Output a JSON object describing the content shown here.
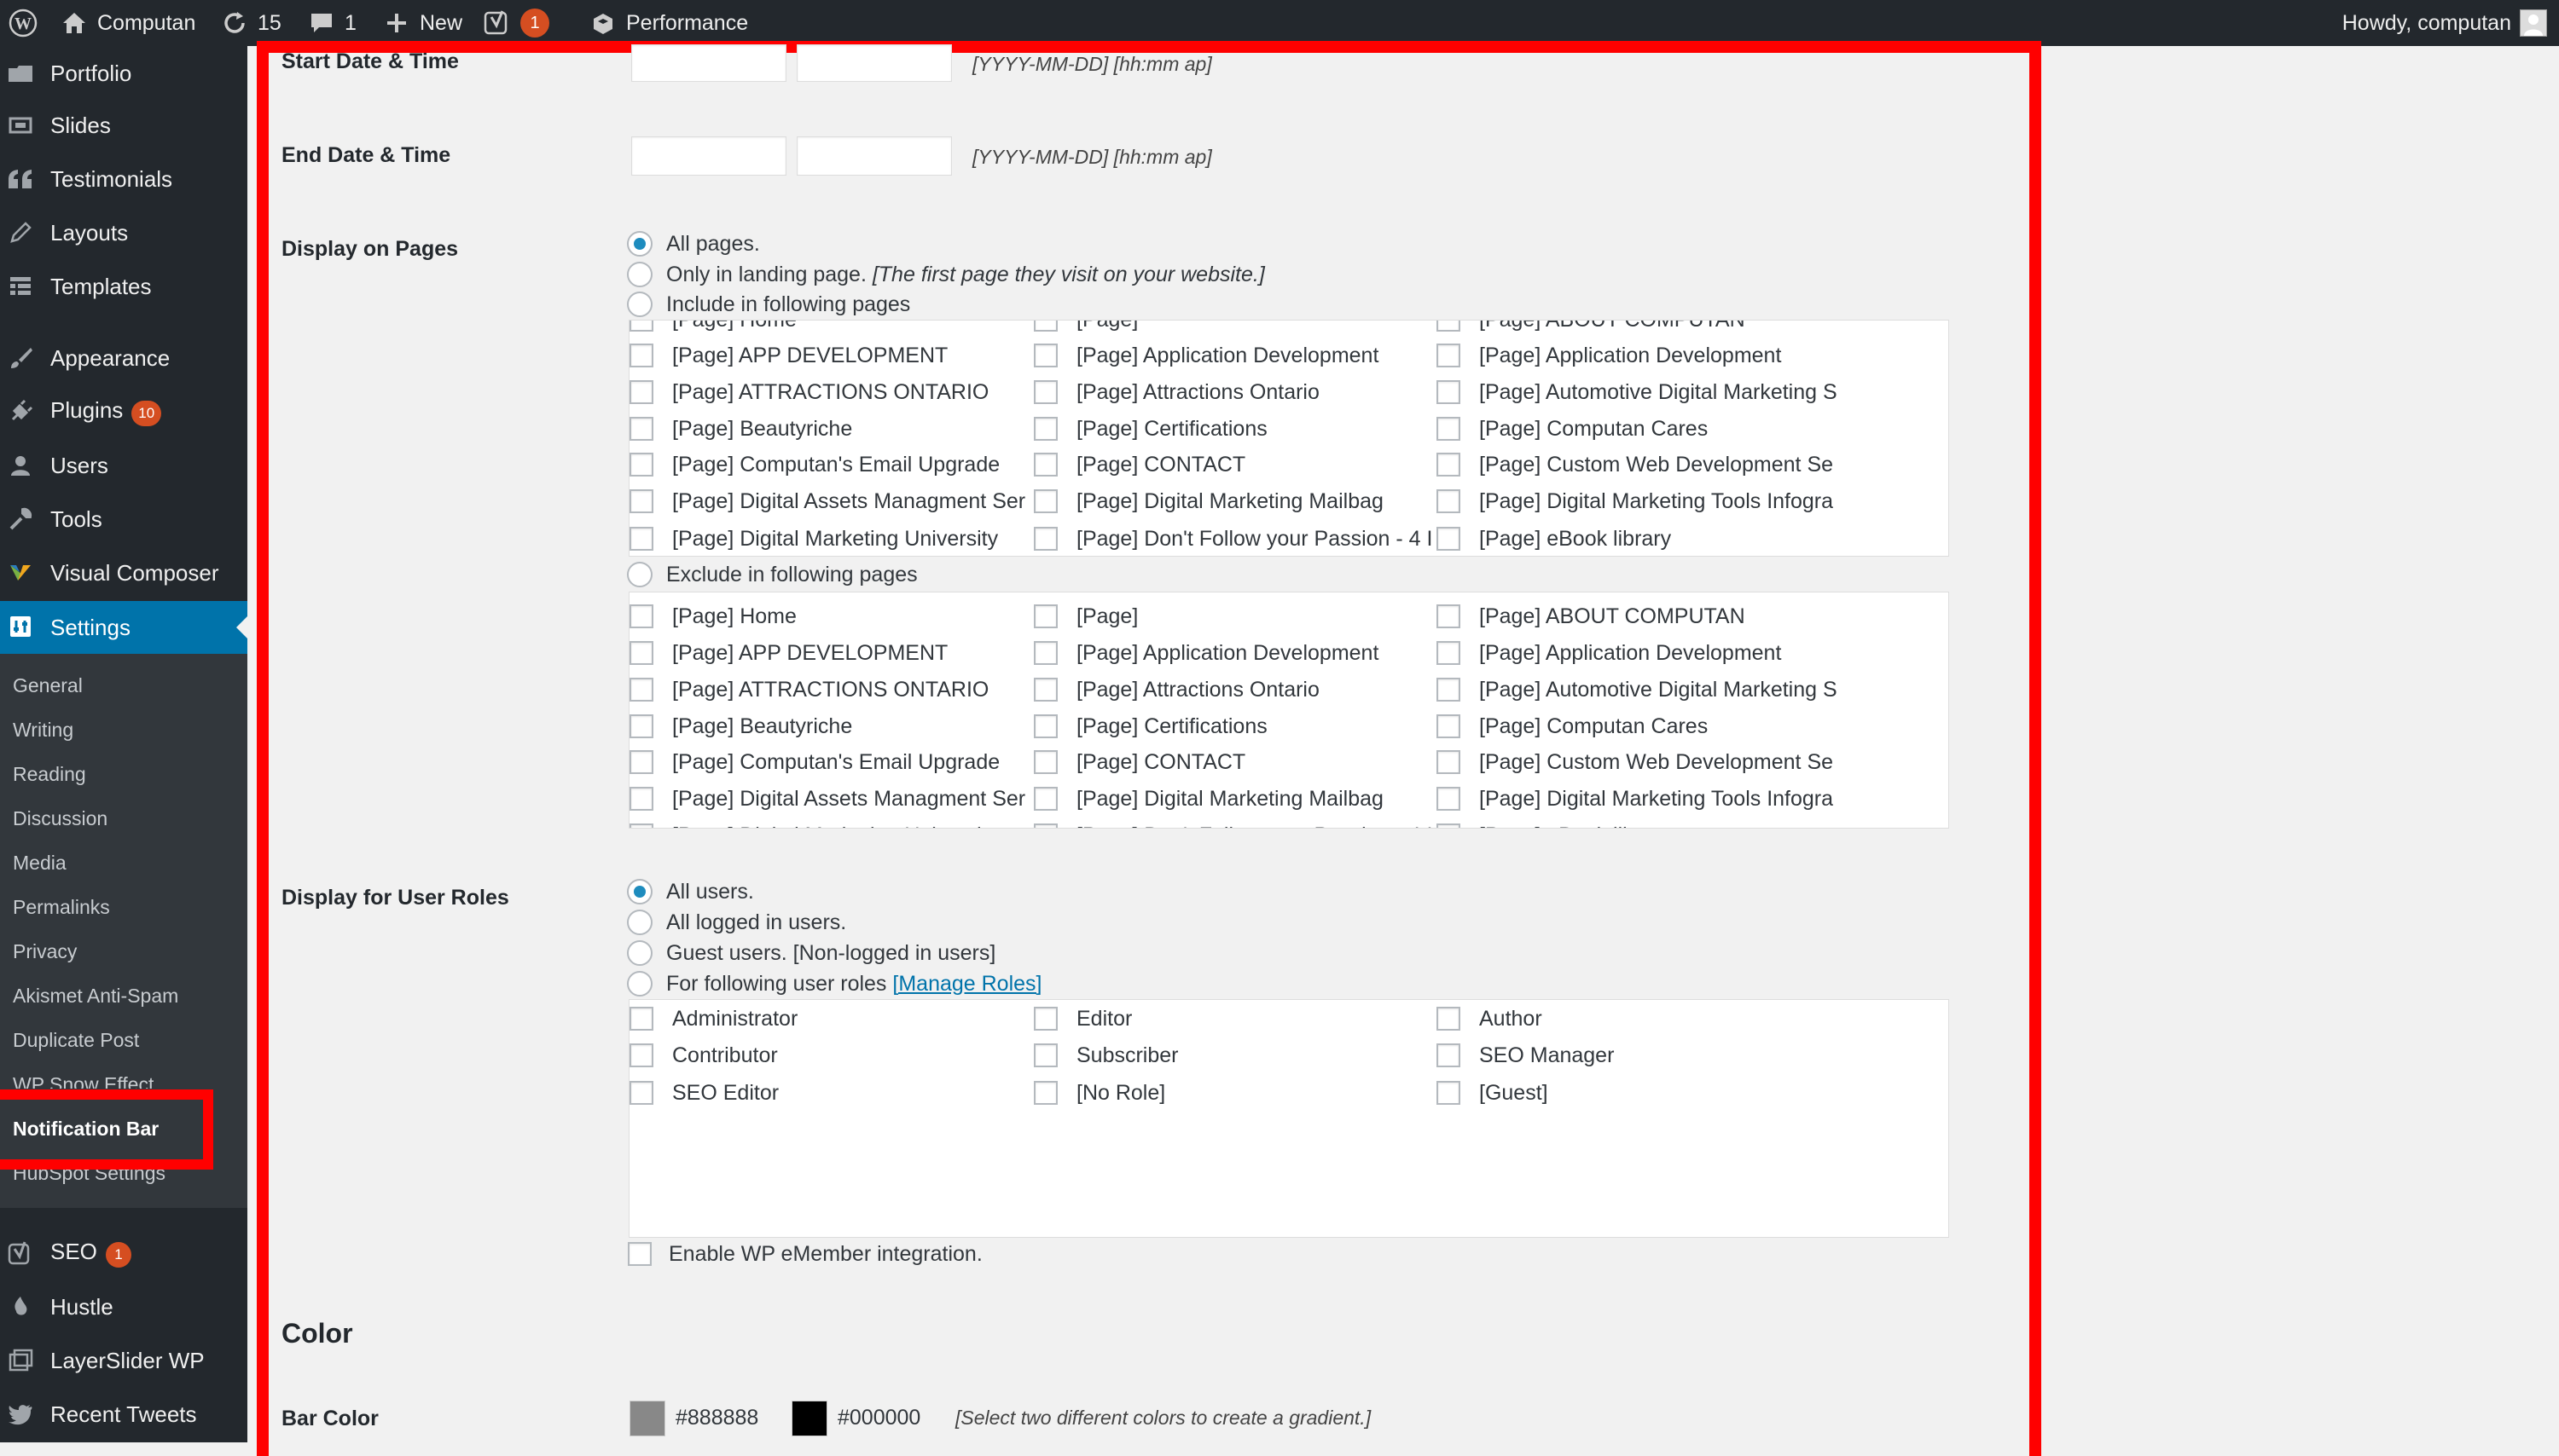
{
  "admin_bar": {
    "site_name": "Computan",
    "updates_count": "15",
    "comments_count": "1",
    "new_label": "New",
    "yoast_count": "1",
    "performance_label": "Performance",
    "howdy_text": "Howdy, computan"
  },
  "sidebar": {
    "items": [
      {
        "label": "Portfolio",
        "icon": "portfolio-icon"
      },
      {
        "label": "Slides",
        "icon": "slides-icon"
      },
      {
        "label": "Testimonials",
        "icon": "quote-icon"
      },
      {
        "label": "Layouts",
        "icon": "pencil-icon"
      },
      {
        "label": "Templates",
        "icon": "grid-icon"
      },
      {
        "label": "Appearance",
        "icon": "brush-icon"
      },
      {
        "label": "Plugins",
        "icon": "plugin-icon",
        "badge": "10"
      },
      {
        "label": "Users",
        "icon": "user-icon"
      },
      {
        "label": "Tools",
        "icon": "wrench-icon"
      },
      {
        "label": "Visual Composer",
        "icon": "visual-composer-icon"
      },
      {
        "label": "Settings",
        "icon": "settings-icon"
      }
    ],
    "submenu": [
      "General",
      "Writing",
      "Reading",
      "Discussion",
      "Media",
      "Permalinks",
      "Privacy",
      "Akismet Anti-Spam",
      "Duplicate Post",
      "WP Snow Effect",
      "Notification Bar",
      "HubSpot Settings"
    ],
    "bottom_items": [
      {
        "label": "SEO",
        "icon": "yoast-icon",
        "badge": "1"
      },
      {
        "label": "Hustle",
        "icon": "hustle-icon"
      },
      {
        "label": "LayerSlider WP",
        "icon": "layers-icon"
      },
      {
        "label": "Recent Tweets",
        "icon": "twitter-icon"
      }
    ]
  },
  "form": {
    "start_label": "Start Date & Time",
    "end_label": "End Date & Time",
    "date_hint": "[YYYY-MM-DD] [hh:mm ap]",
    "display_pages_label": "Display on Pages",
    "pages_options": {
      "all": "All pages.",
      "landing": "Only in landing page.",
      "landing_note": "[The first page they visit on your website.]",
      "include": "Include in following pages",
      "exclude": "Exclude in following pages"
    },
    "pages": [
      "[Page] Home",
      "[Page]",
      "[Page] ABOUT COMPUTAN",
      "[Page] APP DEVELOPMENT",
      "[Page] Application Development",
      "[Page] Application Development",
      "[Page] ATTRACTIONS ONTARIO",
      "[Page] Attractions Ontario",
      "[Page] Automotive Digital Marketing S",
      "[Page] Beautyriche",
      "[Page] Certifications",
      "[Page] Computan Cares",
      "[Page] Computan's Email Upgrade",
      "[Page] CONTACT",
      "[Page] Custom Web Development Se",
      "[Page] Digital Assets Managment Ser",
      "[Page] Digital Marketing Mailbag",
      "[Page] Digital Marketing Tools Infogra",
      "[Page] Digital Marketing University",
      "[Page] Don't Follow your Passion - 4 I",
      "[Page] eBook library"
    ],
    "roles_label": "Display for User Roles",
    "roles_options": {
      "all": "All users.",
      "logged": "All logged in users.",
      "guest": "Guest users. [Non-logged in users]",
      "following": "For following user roles",
      "manage_link": "[Manage Roles]"
    },
    "roles": [
      "Administrator",
      "Editor",
      "Author",
      "Contributor",
      "Subscriber",
      "SEO Manager",
      "SEO Editor",
      "[No Role]",
      "[Guest]"
    ],
    "emember_label": "Enable WP eMember integration.",
    "color_title": "Color",
    "bar_color_label": "Bar Color",
    "bar_color_1": "#888888",
    "bar_color_2": "#000000",
    "gradient_hint": "[Select two different colors to create a gradient.]"
  },
  "colors": {
    "admin_bg": "#23282d",
    "accent": "#0073aa",
    "highlight_box": "#ff0000",
    "badge": "#d54e21"
  }
}
